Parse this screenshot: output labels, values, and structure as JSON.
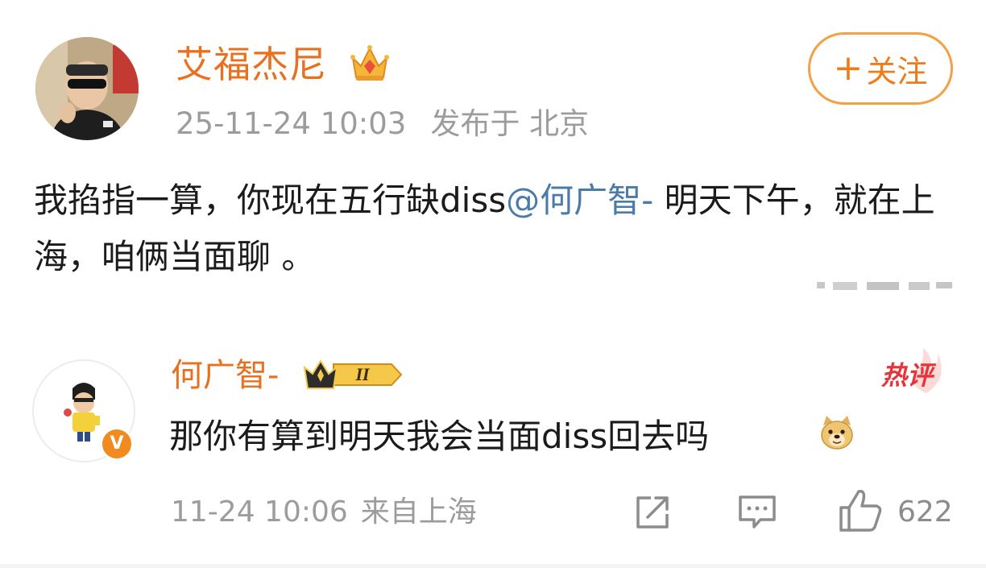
{
  "post": {
    "author": "艾福杰尼",
    "follow_button": "关注",
    "follow_plus": "+",
    "timestamp": "25-11-24 10:03",
    "location": "发布于 北京",
    "text_before": "我掐指一算，你现在五行缺diss",
    "mention": "@何广智-",
    "text_after": " 明天下午，就在上海，咱俩当面聊 。"
  },
  "comment": {
    "author": "何广智-",
    "level_badge": "II",
    "verified_badge": "V",
    "hot_tag": "热评",
    "text": "那你有算到明天我会当面diss回去吗",
    "timestamp": "11-24 10:06",
    "source": "来自上海",
    "like_count": "622"
  },
  "colors": {
    "username": "#e8701f",
    "mention": "#4a7bab",
    "follow_border": "#f5a042",
    "hot_tag": "#e5343a",
    "meta": "#9c9c9c"
  },
  "icons": {
    "post_crown": "crown-icon",
    "comment_crown": "crown-level-icon",
    "emoji": "doge-emoji",
    "share": "share-icon",
    "comment": "comment-icon",
    "like": "thumbs-up-icon"
  }
}
